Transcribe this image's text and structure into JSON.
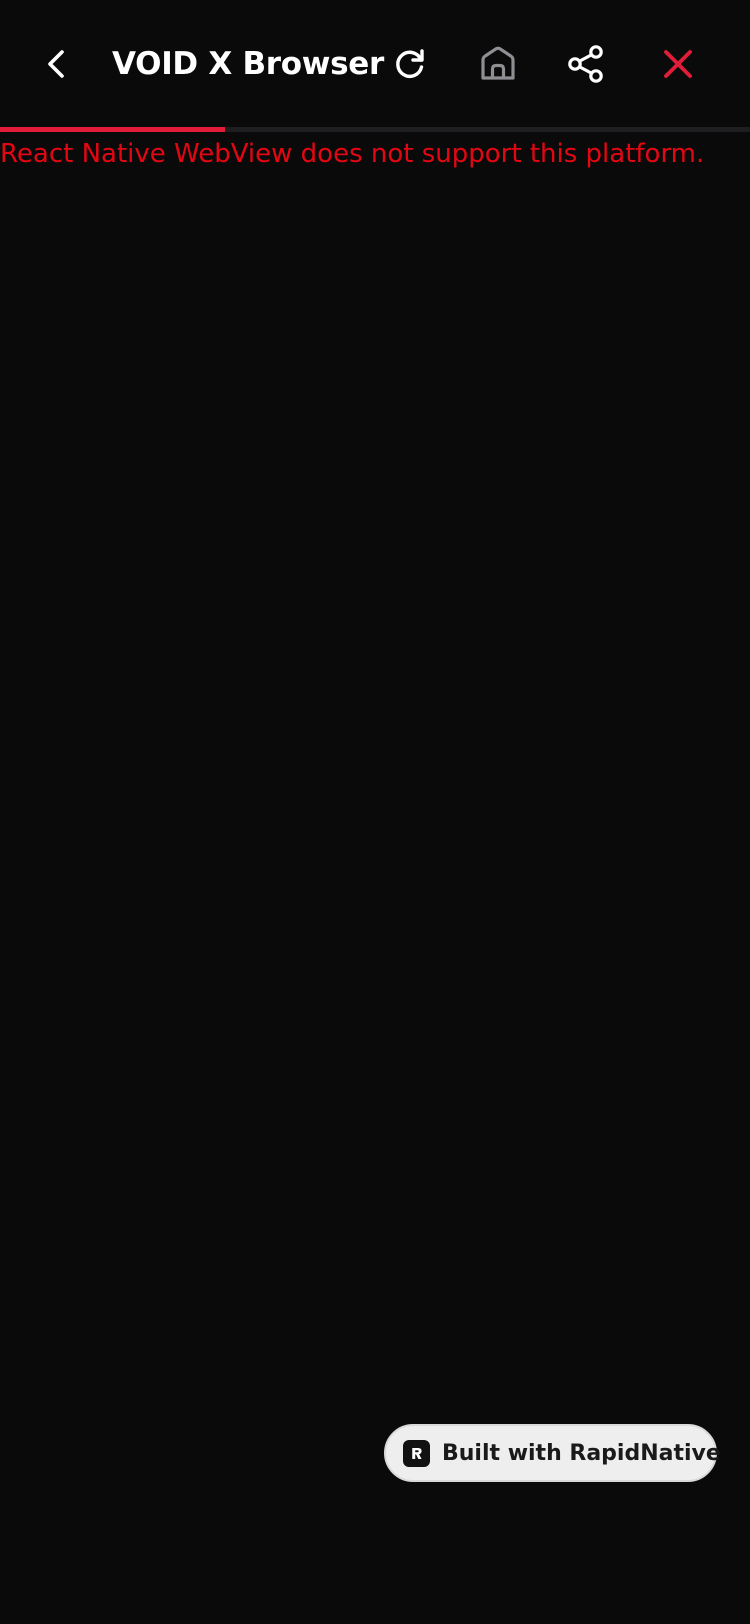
{
  "header": {
    "title": "VOID X Browser",
    "icons": {
      "back": "chevron-left-icon",
      "reload": "reload-icon",
      "home": "home-icon",
      "share": "share-icon",
      "close": "close-icon"
    }
  },
  "progress": {
    "fraction": 0.3
  },
  "webview": {
    "error_message": "React Native WebView does not support this platform."
  },
  "badge": {
    "label": "Built with RapidNative",
    "icon": "rapidnative-logo"
  },
  "colors": {
    "background": "#0a0a0b",
    "accent": "#e11d3a",
    "error": "#e30613",
    "title": "#ffffff",
    "home_icon": "#8e8e93",
    "badge_background": "#eeeeee"
  }
}
